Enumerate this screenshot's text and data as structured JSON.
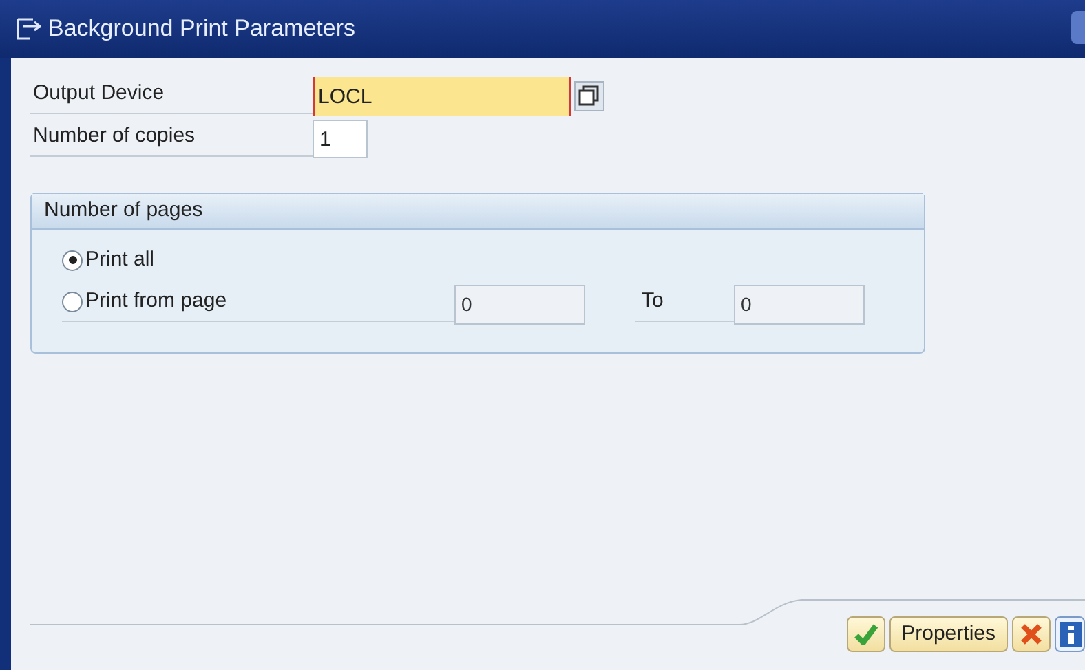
{
  "window": {
    "title": "Background Print Parameters"
  },
  "fields": [
    {
      "label": "Output Device",
      "value": "LOCL",
      "required": true
    },
    {
      "label": "Number of copies",
      "value": "1",
      "required": false
    }
  ],
  "pages_group": {
    "title": "Number of pages",
    "options": [
      {
        "label": "Print all",
        "selected": true
      },
      {
        "label": "Print from page",
        "selected": false
      }
    ],
    "from_value": "0",
    "to_label": "To",
    "to_value": "0"
  },
  "buttons": [
    {
      "kind": "confirm"
    },
    {
      "kind": "text",
      "label": "Properties"
    },
    {
      "kind": "cancel"
    },
    {
      "kind": "info"
    }
  ]
}
